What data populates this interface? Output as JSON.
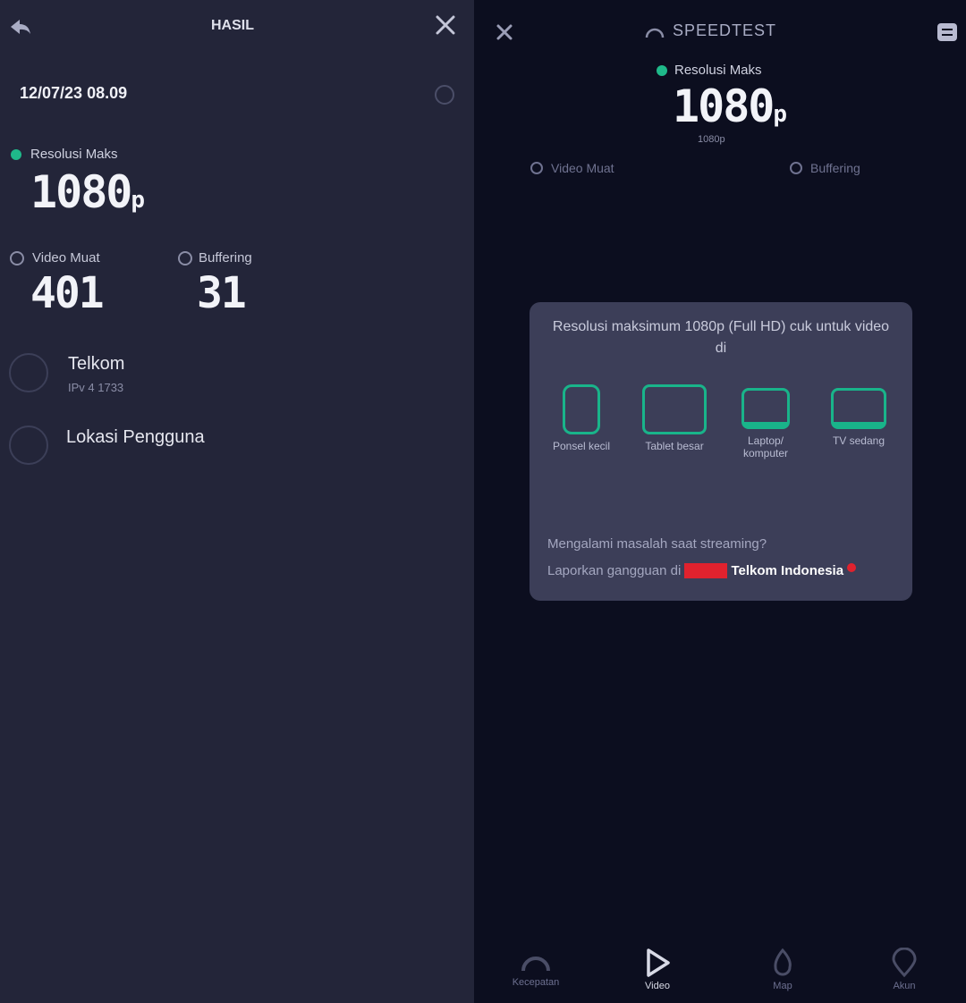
{
  "left": {
    "header_title": "HASIL",
    "date": "12/07/23 08.09",
    "resolution_label": "Resolusi Maks",
    "resolution_value": "1080",
    "resolution_unit": "p",
    "video_load_label": "Video Muat",
    "video_load_value": "401",
    "buffering_label": "Buffering",
    "buffering_value": "31",
    "provider_name": "Telkom",
    "provider_sub": "IPv 4 1733",
    "location_label": "Lokasi Pengguna"
  },
  "right": {
    "header_title": "SPEEDTEST",
    "resolution_label": "Resolusi Maks",
    "resolution_value": "1080",
    "resolution_unit": "p",
    "resolution_sub": "1080p",
    "video_load_label": "Video Muat",
    "buffering_label": "Buffering",
    "card": {
      "text": "Resolusi maksimum 1080p (Full HD) cuk untuk video di",
      "devices": [
        {
          "label": "Ponsel kecil"
        },
        {
          "label": "Tablet besar"
        },
        {
          "label": "Laptop/ komputer"
        },
        {
          "label": "TV sedang"
        }
      ],
      "footer_line1": "Mengalami masalah saat streaming?",
      "footer_line2": "Laporkan gangguan di",
      "footer_link": "Telkom Indonesia"
    },
    "nav": [
      {
        "label": "Kecepatan"
      },
      {
        "label": "Video"
      },
      {
        "label": "Map"
      },
      {
        "label": "Akun"
      }
    ]
  }
}
